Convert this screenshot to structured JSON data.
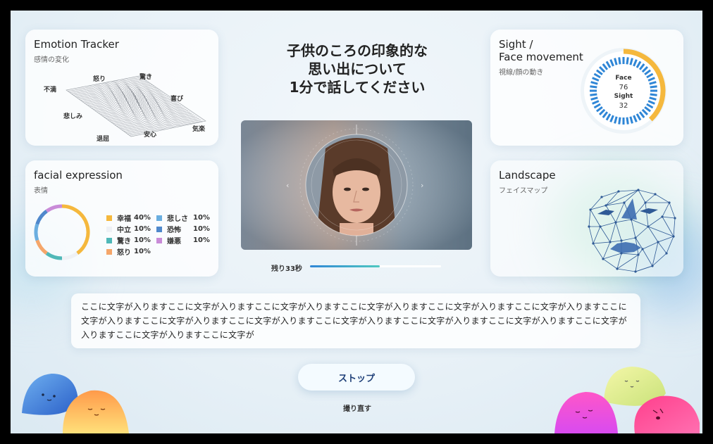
{
  "emotion_tracker": {
    "title": "Emotion Tracker",
    "subtitle": "感情の変化",
    "labels": [
      "怒り",
      "驚き",
      "不満",
      "喜び",
      "悲しみ",
      "気楽",
      "退屈",
      "安心"
    ]
  },
  "facial_expression": {
    "title": "facial expression",
    "subtitle": "表情",
    "items": [
      {
        "name": "幸福",
        "value": "40%",
        "percent": 40,
        "color": "#f5b83d"
      },
      {
        "name": "中立",
        "value": "10%",
        "percent": 10,
        "color": "#eef1f5"
      },
      {
        "name": "驚き",
        "value": "10%",
        "percent": 10,
        "color": "#4fb8b8"
      },
      {
        "name": "怒り",
        "value": "10%",
        "percent": 10,
        "color": "#f5a66a"
      },
      {
        "name": "悲しさ",
        "value": "10%",
        "percent": 10,
        "color": "#6aaee0"
      },
      {
        "name": "恐怖",
        "value": "10%",
        "percent": 10,
        "color": "#4f88cc"
      },
      {
        "name": "嫌悪",
        "value": "10%",
        "percent": 10,
        "color": "#c98bd8"
      }
    ]
  },
  "question": "子供のころの印象的な\n思い出について\n1分で話してください",
  "sight": {
    "title": "Sight /\nFace movement",
    "subtitle": "視線/顔の動き",
    "face_label": "Face",
    "face_value": "76",
    "sight_label": "Sight",
    "sight_value": "32",
    "face_percent": 76,
    "sight_percent": 32
  },
  "landscape": {
    "title": "Landscape",
    "subtitle": "フェイスマップ"
  },
  "timer": {
    "label": "残り33秒",
    "progress": 0.53
  },
  "transcript": "ここに文字が入りますここに文字が入りますここに文字が入りますここに文字が入りますここに文字が入りますここに文字が入りますここに文字が入りますここに文字が入りますここに文字が入りますここに文字が入りますここに文字が入りますここに文字が入りますここに文字が入りますここに文字が入りますここに文字が",
  "buttons": {
    "stop": "ストップ",
    "retake": "撮り直す"
  },
  "colors": {
    "accent_orange": "#f5b83d",
    "accent_blue": "#2f86d6",
    "stop_text": "#1e3f78"
  }
}
